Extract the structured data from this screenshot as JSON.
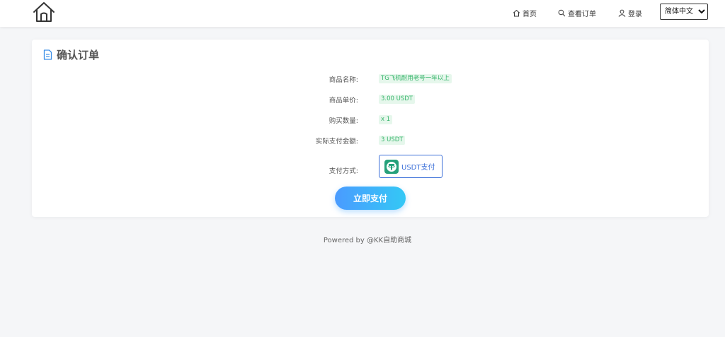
{
  "header": {
    "nav": [
      {
        "label": "首页",
        "icon": "home-icon"
      },
      {
        "label": "查看订单",
        "icon": "search-icon"
      },
      {
        "label": "登录",
        "icon": "user-icon"
      }
    ],
    "language": {
      "selected": "简体中文",
      "options": [
        "简体中文"
      ]
    }
  },
  "card": {
    "title": "确认订单",
    "rows": [
      {
        "label": "商品名称:",
        "value": "TG飞机耐用老号一年以上"
      },
      {
        "label": "商品单价:",
        "value": "3.00 USDT"
      },
      {
        "label": "购买数量:",
        "value": "x 1"
      },
      {
        "label": "实际支付金额:",
        "value": "3 USDT"
      }
    ],
    "payment": {
      "label": "支付方式:",
      "option": "USDT支付",
      "icon": "tether-icon"
    },
    "submit_label": "立即支付"
  },
  "footer": {
    "text": "Powered by @KK自助商城"
  },
  "colors": {
    "accent": "#3b6fd8",
    "tag_bg": "#e6f7ec",
    "tag_text": "#37b56b",
    "tether": "#26a17b",
    "button_gradient": [
      "#4a9bff",
      "#34c8f5"
    ]
  }
}
